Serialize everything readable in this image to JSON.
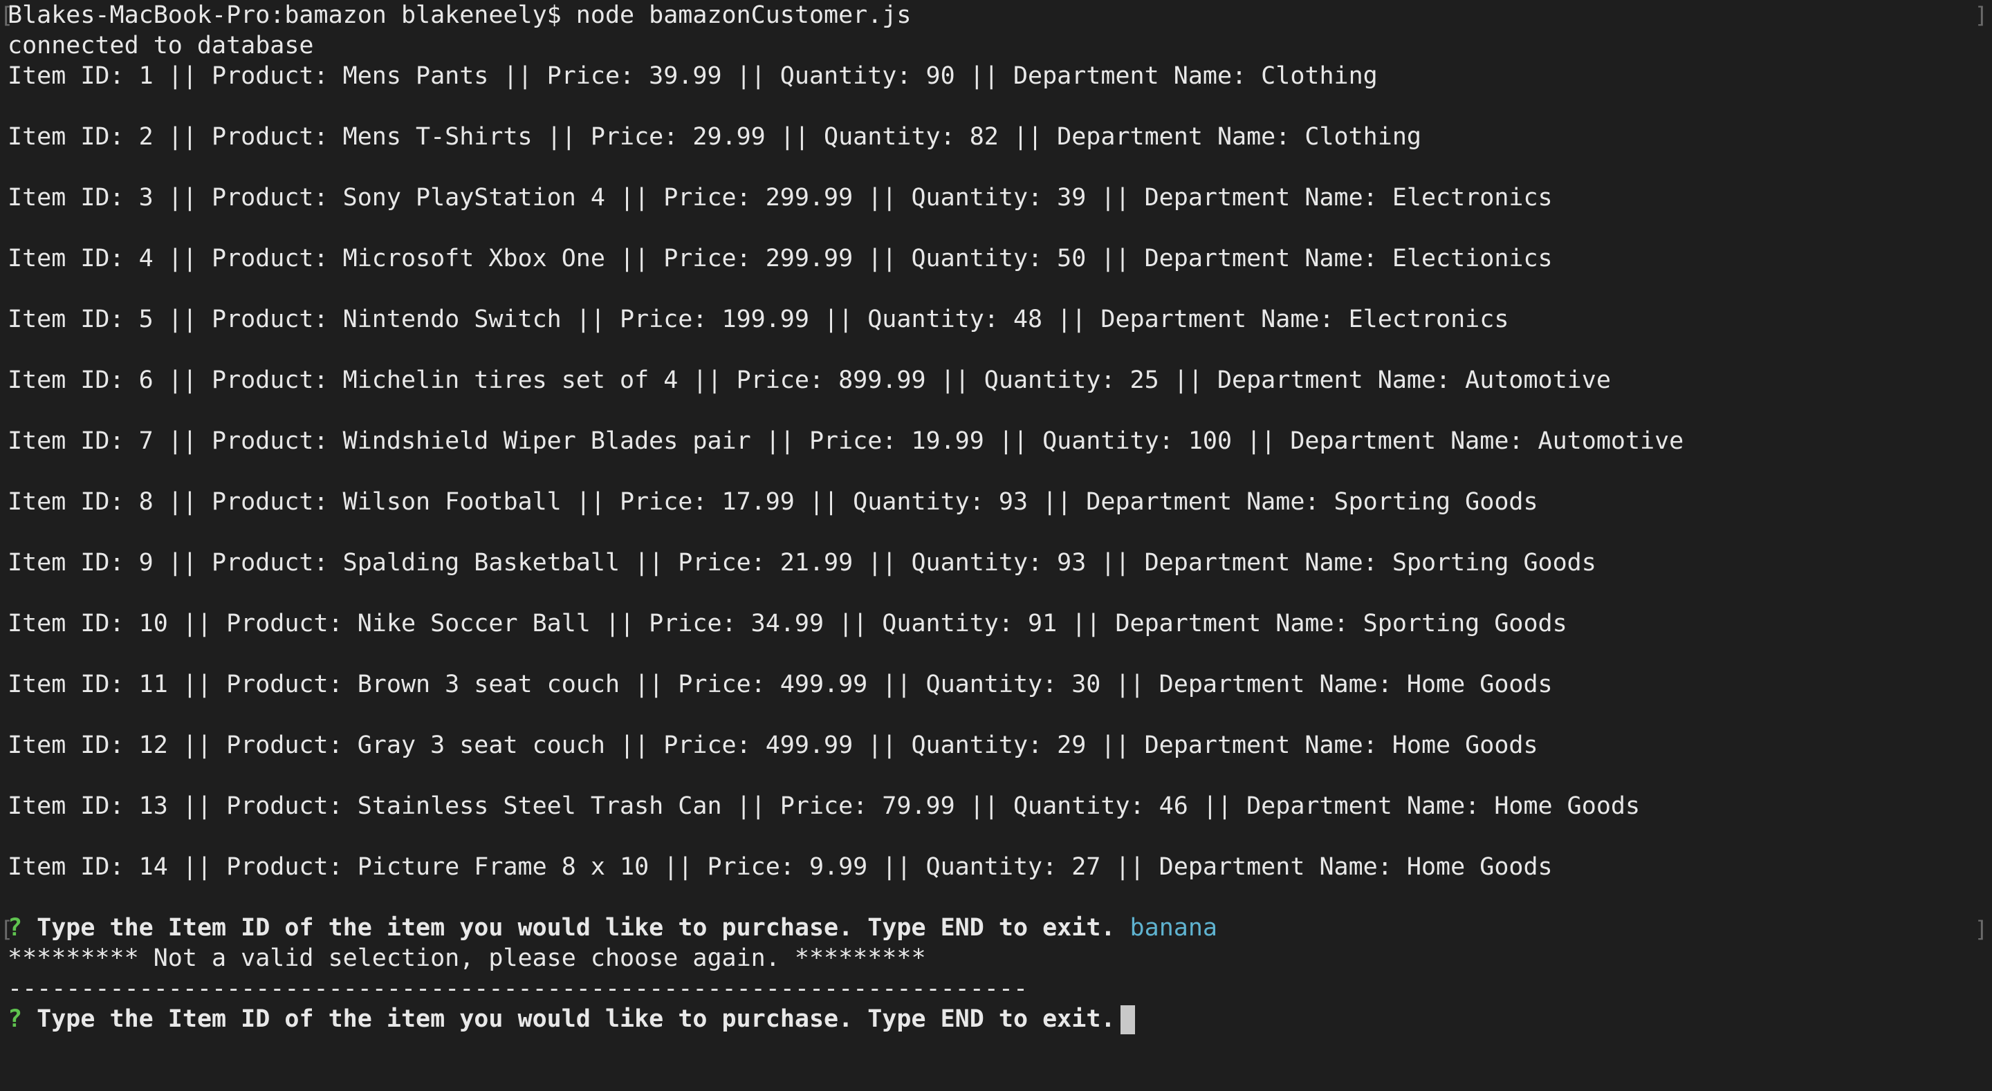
{
  "terminal": {
    "prompt": "Blakes-MacBook-Pro:bamazon blakeneely$ node bamazonCustomer.js",
    "connected": "connected to database",
    "items": [
      "Item ID: 1 || Product: Mens Pants || Price: 39.99 || Quantity: 90 || Department Name: Clothing",
      "Item ID: 2 || Product: Mens T-Shirts || Price: 29.99 || Quantity: 82 || Department Name: Clothing",
      "Item ID: 3 || Product: Sony PlayStation 4 || Price: 299.99 || Quantity: 39 || Department Name: Electronics",
      "Item ID: 4 || Product: Microsoft Xbox One || Price: 299.99 || Quantity: 50 || Department Name: Electionics",
      "Item ID: 5 || Product: Nintendo Switch || Price: 199.99 || Quantity: 48 || Department Name: Electronics",
      "Item ID: 6 || Product: Michelin tires set of 4 || Price: 899.99 || Quantity: 25 || Department Name: Automotive",
      "Item ID: 7 || Product: Windshield Wiper Blades pair || Price: 19.99 || Quantity: 100 || Department Name: Automotive",
      "Item ID: 8 || Product: Wilson Football || Price: 17.99 || Quantity: 93 || Department Name: Sporting Goods",
      "Item ID: 9 || Product: Spalding Basketball || Price: 21.99 || Quantity: 93 || Department Name: Sporting Goods",
      "Item ID: 10 || Product: Nike Soccer Ball || Price: 34.99 || Quantity: 91 || Department Name: Sporting Goods",
      "Item ID: 11 || Product: Brown 3 seat couch || Price: 499.99 || Quantity: 30 || Department Name: Home Goods",
      "Item ID: 12 || Product: Gray 3 seat couch || Price: 499.99 || Quantity: 29 || Department Name: Home Goods",
      "Item ID: 13 || Product: Stainless Steel Trash Can || Price: 79.99 || Quantity: 46 || Department Name: Home Goods",
      "Item ID: 14 || Product: Picture Frame 8 x 10 || Price: 9.99 || Quantity: 27 || Department Name: Home Goods"
    ],
    "question_mark": "?",
    "question": "Type the Item ID of the item you would like to purchase. Type END to exit.",
    "answer": "banana",
    "error": "********* Not a valid selection, please choose again. *********",
    "separator": "----------------------------------------------------------------------",
    "colors": {
      "background": "#1e1e1e",
      "text": "#e8e8e8",
      "question_mark": "#5fc34f",
      "answer": "#5fb3d0"
    }
  }
}
